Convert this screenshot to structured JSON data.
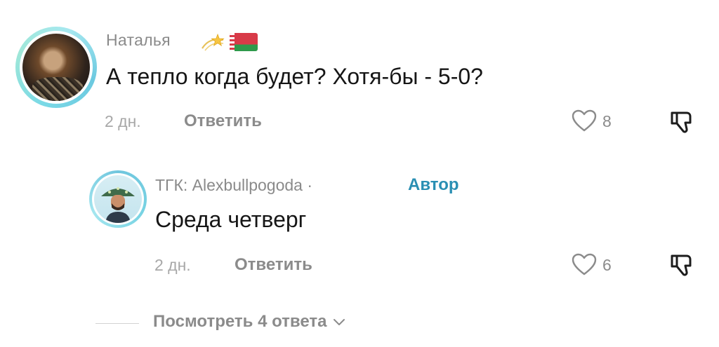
{
  "comments": [
    {
      "author": "Наталья",
      "text": "А тепло когда будет? Хотя-бы - 5-0?",
      "time": "2 дн.",
      "reply_label": "Ответить",
      "likes": "8",
      "icons": {
        "avatar": "user-photo",
        "sparkle": "dizzy-star-emoji",
        "flag": "belarus-flag-emoji",
        "like": "heart-outline-icon",
        "dislike": "thumbs-down-icon"
      }
    },
    {
      "author": "ТГК: Alexbullpogoda",
      "author_separator": "·",
      "badge": "Автор",
      "text": "Среда четверг",
      "time": "2 дн.",
      "reply_label": "Ответить",
      "likes": "6",
      "icons": {
        "avatar": "user-cartoon",
        "like": "heart-outline-icon",
        "dislike": "thumbs-down-icon"
      }
    }
  ],
  "view_replies": {
    "label": "Посмотреть 4 ответа",
    "icon": "chevron-down-icon"
  },
  "colors": {
    "accent": "#2a8fb3",
    "text": "#161616",
    "muted": "#8b8b8b",
    "avatar_ring": "#7ad9e6"
  }
}
